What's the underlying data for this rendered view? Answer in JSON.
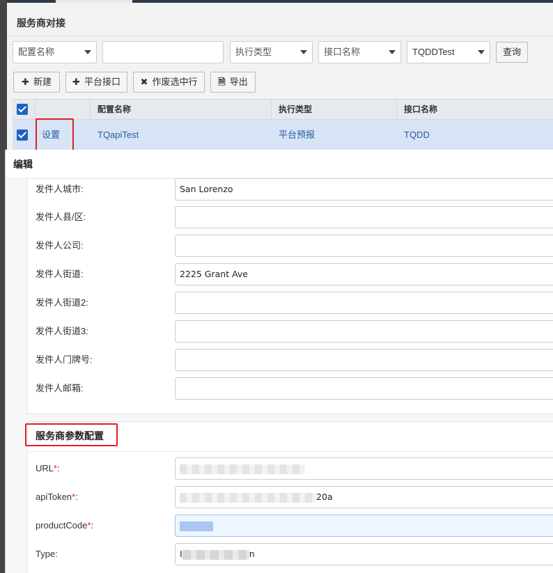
{
  "panel": {
    "title": "服务商对接"
  },
  "filters": {
    "config_name": "配置名称",
    "search_value": "",
    "exec_type": "执行类型",
    "api_name": "接口名称",
    "test_value": "TQDDTest",
    "query_label": "查询"
  },
  "toolbar": {
    "new_label": "新建",
    "platform_api_label": "平台接口",
    "void_label": "作废选中行",
    "export_label": "导出"
  },
  "grid": {
    "headers": [
      "配置名称",
      "执行类型",
      "接口名称"
    ],
    "row": {
      "action": "设置",
      "config_name": "TQapiTest",
      "exec_type": "平台预报",
      "api_name": "TQDD"
    }
  },
  "modal": {
    "title": "编辑",
    "fields": [
      {
        "label": "发件人城市:",
        "value": "San Lorenzo"
      },
      {
        "label": "发件人县/区:",
        "value": ""
      },
      {
        "label": "发件人公司:",
        "value": ""
      },
      {
        "label": "发件人街道:",
        "value": "2225 Grant Ave"
      },
      {
        "label": "发件人街道2:",
        "value": ""
      },
      {
        "label": "发件人街道3:",
        "value": ""
      },
      {
        "label": "发件人门牌号:",
        "value": ""
      },
      {
        "label": "发件人邮箱:",
        "value": ""
      }
    ],
    "section2_title": "服务商参数配置",
    "params": [
      {
        "label": "URL",
        "suffix": ":",
        "value": ""
      },
      {
        "label": "apiToken",
        "suffix": ":",
        "value": "20a"
      },
      {
        "label": "productCode",
        "suffix": ":",
        "value": ""
      },
      {
        "label": "Type:",
        "value_start": "I",
        "value_end": "n"
      }
    ],
    "required_mark": "*"
  },
  "icons": {
    "plus": "plus-icon",
    "times": "times-icon",
    "export": "export-file-icon",
    "caret": "caret-down-icon",
    "checkbox": "checkbox-checked-icon"
  },
  "colors": {
    "accent": "#1e63c3",
    "link": "#2c5aa0",
    "row_selected": "#d6e4f5",
    "highlight": "#e02020"
  }
}
